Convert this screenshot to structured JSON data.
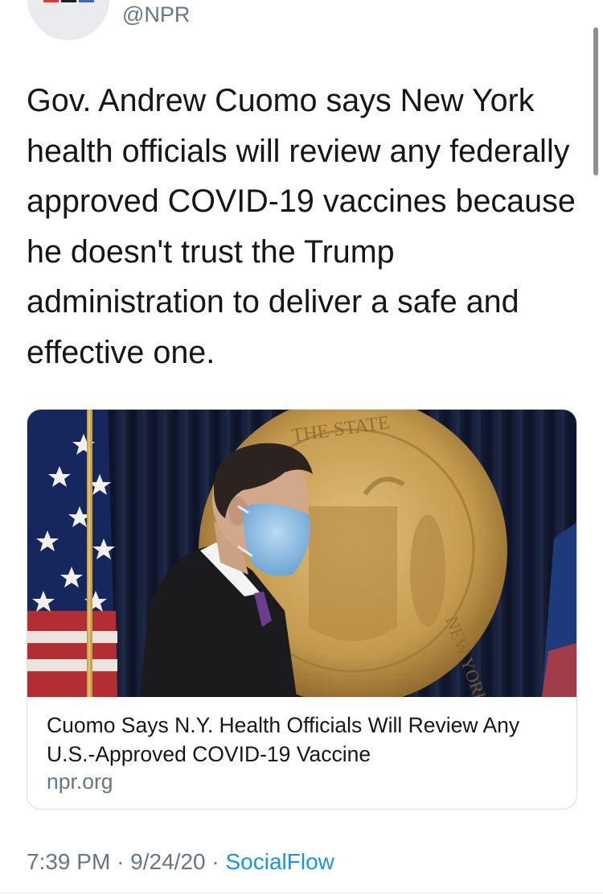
{
  "tweet": {
    "handle": "@NPR",
    "text": "Gov. Andrew Cuomo says New York health officials will review any federally approved COVID-19 vaccines because he doesn't trust the Trump administration to deliver a safe and effective one.",
    "time": "7:39 PM",
    "date": "9/24/20",
    "separator": "·",
    "source": "SocialFlow"
  },
  "card": {
    "title": "Cuomo Says N.Y. Health Officials Will Review Any U.S.-Approved COVID-19 Vaccine",
    "domain": "npr.org",
    "image_icon": "photo-icon"
  },
  "colors": {
    "logo_red": "#e33b2f",
    "logo_black": "#1c1c1c",
    "logo_blue": "#3c69b4",
    "link_blue": "#1b95e0",
    "muted_gray": "#657786",
    "seal_gold": "#c49a4e"
  }
}
